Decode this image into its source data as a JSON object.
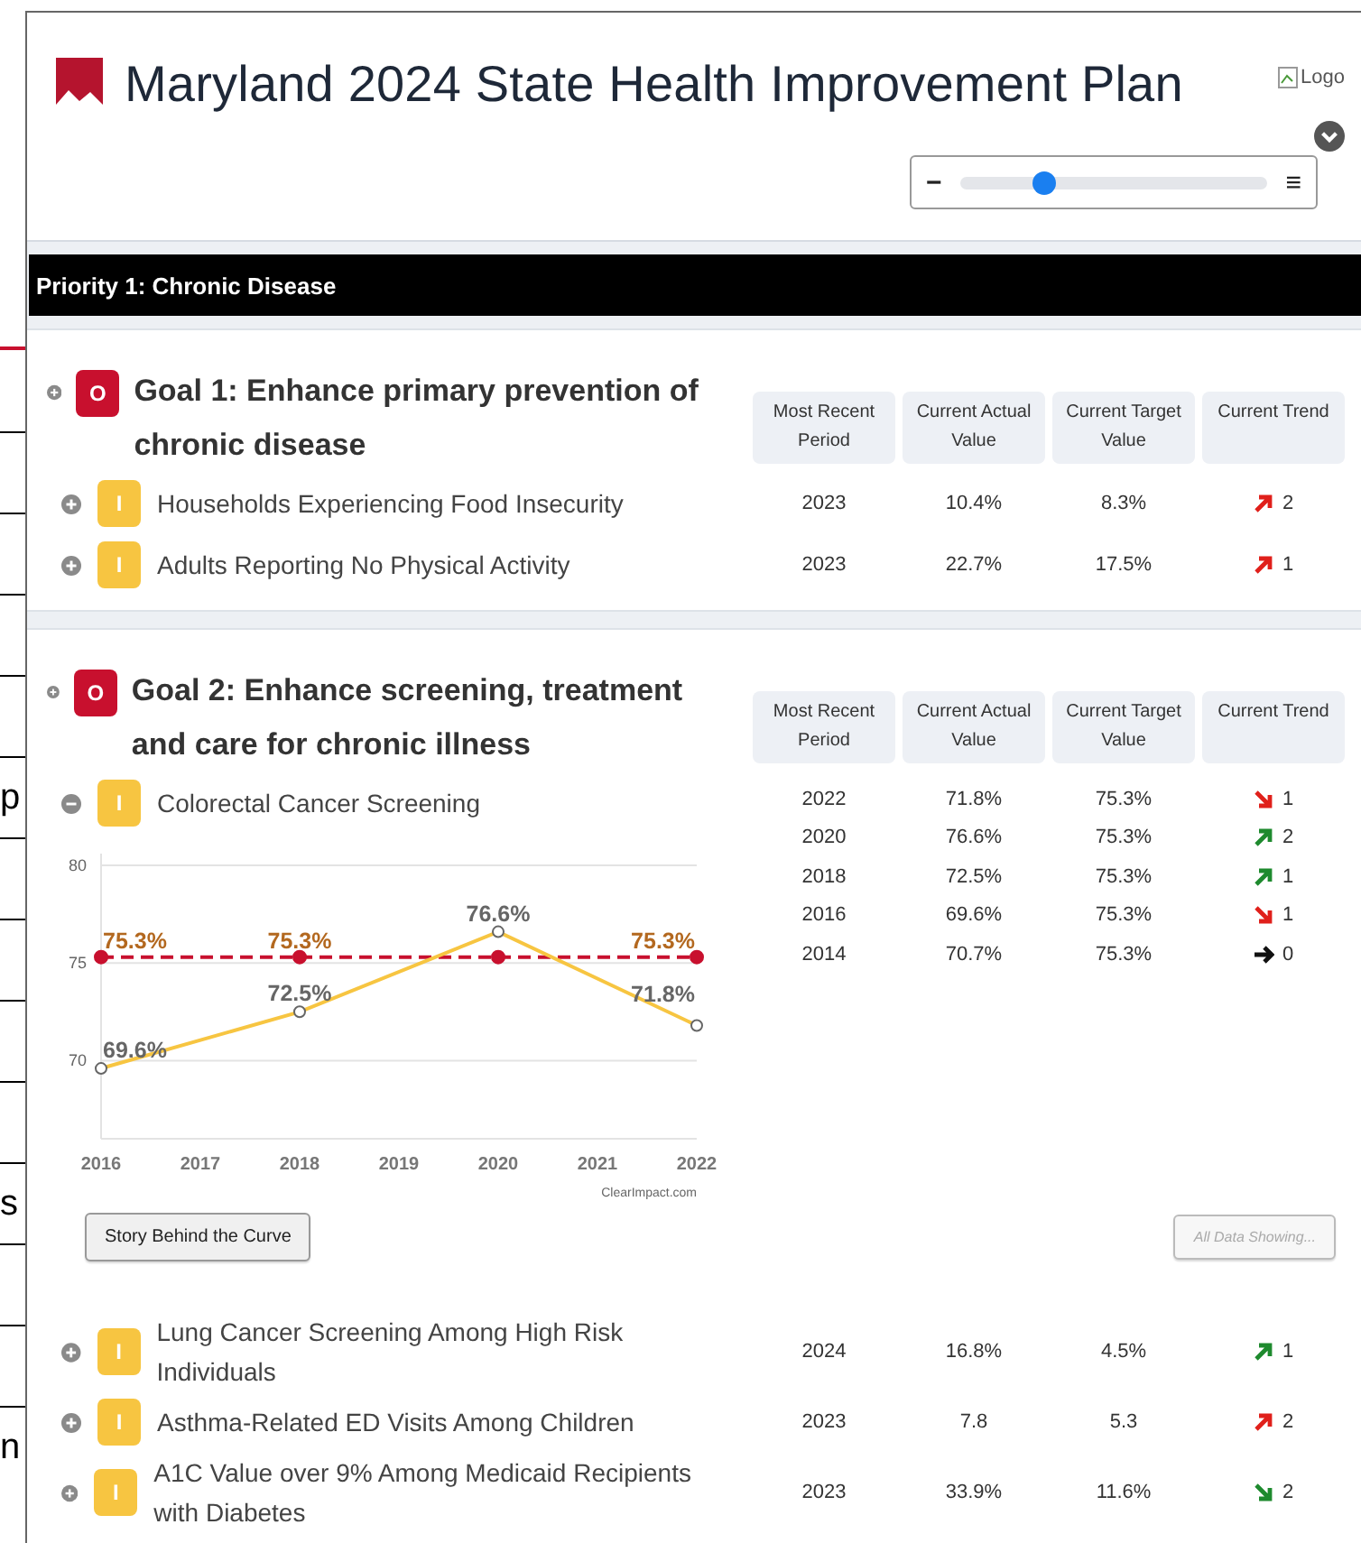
{
  "background_document": {
    "fragments": [
      "p",
      "s",
      "n"
    ]
  },
  "header": {
    "title": "Maryland 2024 State Health Improvement Plan",
    "logo_alt": "Logo",
    "zoom_out": "−",
    "menu": "≡",
    "zoom_slider": {
      "level": 0.27
    }
  },
  "priority": {
    "title": "Priority 1: Chronic Disease"
  },
  "goals": [
    {
      "badge": {
        "text": "O",
        "color": "#c8102e"
      },
      "title": "Goal 1: Enhance primary prevention of chronic disease",
      "columns": [
        "Most Recent Period",
        "Current Actual Value",
        "Current Target Value",
        "Current Trend"
      ],
      "measures": [
        {
          "badge": {
            "text": "I",
            "color": "#f7c541"
          },
          "title": "Households Experiencing Food Insecurity",
          "expanded": false,
          "period": "2023",
          "actual": "10.4%",
          "target": "8.3%",
          "trend": {
            "kind": "up",
            "color": "#e0201b",
            "count": "2"
          }
        },
        {
          "badge": {
            "text": "I",
            "color": "#f7c541"
          },
          "title": "Adults Reporting No Physical Activity",
          "expanded": false,
          "period": "2023",
          "actual": "22.7%",
          "target": "17.5%",
          "trend": {
            "kind": "up",
            "color": "#e0201b",
            "count": "1"
          }
        }
      ]
    },
    {
      "badge": {
        "text": "O",
        "color": "#c8102e"
      },
      "title": "Goal 2: Enhance screening, treatment and care for chronic illness",
      "columns": [
        "Most Recent Period",
        "Current Actual Value",
        "Current Target Value",
        "Current Trend"
      ],
      "measures": [
        {
          "badge": {
            "text": "I",
            "color": "#f7c541"
          },
          "title": "Colorectal Cancer Screening",
          "expanded": true,
          "history": [
            {
              "period": "2022",
              "actual": "71.8%",
              "target": "75.3%",
              "trend": {
                "kind": "down",
                "color": "#e0201b",
                "count": "1"
              }
            },
            {
              "period": "2020",
              "actual": "76.6%",
              "target": "75.3%",
              "trend": {
                "kind": "up",
                "color": "#1e8a2e",
                "count": "2"
              }
            },
            {
              "period": "2018",
              "actual": "72.5%",
              "target": "75.3%",
              "trend": {
                "kind": "up",
                "color": "#1e8a2e",
                "count": "1"
              }
            },
            {
              "period": "2016",
              "actual": "69.6%",
              "target": "75.3%",
              "trend": {
                "kind": "down",
                "color": "#e0201b",
                "count": "1"
              }
            },
            {
              "period": "2014",
              "actual": "70.7%",
              "target": "75.3%",
              "trend": {
                "kind": "flat",
                "color": "#111111",
                "count": "0"
              }
            }
          ],
          "chart_data": {
            "type": "line",
            "x": [
              2016,
              2018,
              2020,
              2022
            ],
            "xlim": [
              2016,
              2022
            ],
            "ylim": [
              66,
              80.6
            ],
            "xticks": [
              2016,
              2017,
              2018,
              2019,
              2020,
              2021,
              2022
            ],
            "yticks": [
              70,
              75,
              80
            ],
            "grid": true,
            "series": [
              {
                "color": "#f7c541",
                "line_style": "solid",
                "marker": "circle",
                "values": [
                  69.6,
                  72.5,
                  76.6,
                  71.8
                ]
              },
              {
                "color": "#c8102e",
                "line_style": "dashed",
                "marker": "circle",
                "values": [
                  75.3,
                  75.3,
                  75.3,
                  75.3
                ]
              }
            ],
            "value_labels": [
              [
                "69.6%",
                "72.5%",
                "76.6%",
                "71.8%"
              ],
              [
                "75.3%",
                "75.3%",
                null,
                "75.3%"
              ]
            ]
          },
          "chart_credit": "ClearImpact.com",
          "buttons": [
            {
              "label": "Story Behind the Curve",
              "disabled": false
            },
            {
              "label": "All Data Showing...",
              "disabled": true
            }
          ]
        },
        {
          "badge": {
            "text": "I",
            "color": "#f7c541"
          },
          "title": "Lung Cancer Screening Among High Risk Individuals",
          "expanded": false,
          "period": "2024",
          "actual": "16.8%",
          "target": "4.5%",
          "trend": {
            "kind": "up",
            "color": "#1e8a2e",
            "count": "1"
          }
        },
        {
          "badge": {
            "text": "I",
            "color": "#f7c541"
          },
          "title": "Asthma-Related ED Visits Among Children",
          "expanded": false,
          "period": "2023",
          "actual": "7.8",
          "target": "5.3",
          "trend": {
            "kind": "up",
            "color": "#e0201b",
            "count": "2"
          }
        },
        {
          "badge": {
            "text": "I",
            "color": "#f7c541"
          },
          "title": "A1C Value over 9% Among Medicaid Recipients with Diabetes",
          "expanded": false,
          "period": "2023",
          "actual": "33.9%",
          "target": "11.6%",
          "trend": {
            "kind": "down",
            "color": "#1e8a2e",
            "count": "2"
          }
        }
      ]
    }
  ]
}
